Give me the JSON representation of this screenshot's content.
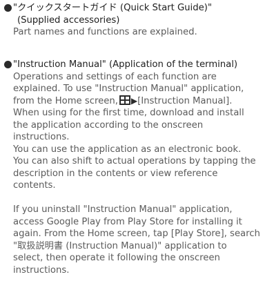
{
  "sections": [
    {
      "heading": "\"クイックスタートガイド (Quick Start Guide)\"",
      "subheading": "(Supplied accessories)",
      "body": "Part names and functions are explained."
    },
    {
      "heading": "\"Instruction Manual\" (Application of the terminal)",
      "para1": {
        "line1": "Operations and settings of each function are",
        "line2": "explained. To use \"Instruction Manual\" application,",
        "line3_prefix": "from the Home screen,",
        "line3_arrow": "▶",
        "line3_suffix": "[Instruction Manual].",
        "line4": "When using for the first time, download and install",
        "line5": "the application according to the onscreen",
        "line6": "instructions.",
        "line7": "You can use the application as an electronic book.",
        "line8": "You can also shift to actual operations by tapping the",
        "line9": "description in the contents or view reference",
        "line10": "contents."
      },
      "para2": {
        "line1": "If you uninstall \"Instruction Manual\" application,",
        "line2": "access Google Play from Play Store for installing it",
        "line3": "again. From the Home screen, tap [Play Store], search",
        "line4": "\"取扱説明書 (Instruction Manual)\" application to",
        "line5": "select, then operate it following the onscreen",
        "line6": "instructions."
      }
    }
  ],
  "colors": {
    "heading": "#1e1e1e",
    "body": "#5a5a5a",
    "bullet": "#2b2b2b"
  },
  "icons": {
    "home_apps": "apps-grid-icon",
    "arrow": "triangle-right-icon"
  }
}
